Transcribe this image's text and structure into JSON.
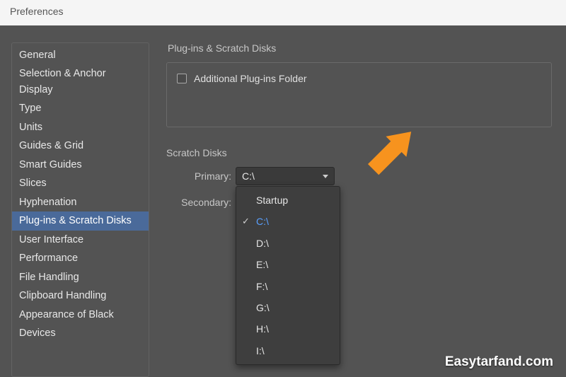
{
  "window": {
    "title": "Preferences"
  },
  "sidebar": {
    "items": [
      {
        "label": "General"
      },
      {
        "label": "Selection & Anchor Display"
      },
      {
        "label": "Type"
      },
      {
        "label": "Units"
      },
      {
        "label": "Guides & Grid"
      },
      {
        "label": "Smart Guides"
      },
      {
        "label": "Slices"
      },
      {
        "label": "Hyphenation"
      },
      {
        "label": "Plug-ins & Scratch Disks",
        "selected": true
      },
      {
        "label": "User Interface"
      },
      {
        "label": "Performance"
      },
      {
        "label": "File Handling"
      },
      {
        "label": "Clipboard Handling"
      },
      {
        "label": "Appearance of Black"
      },
      {
        "label": "Devices"
      }
    ]
  },
  "plugins": {
    "section_title": "Plug-ins & Scratch Disks",
    "checkbox_label": "Additional Plug-ins Folder"
  },
  "scratch": {
    "section_title": "Scratch Disks",
    "primary_label": "Primary:",
    "secondary_label": "Secondary:",
    "primary_value": "C:\\",
    "options": [
      {
        "label": "Startup"
      },
      {
        "label": "C:\\",
        "selected": true
      },
      {
        "label": "D:\\"
      },
      {
        "label": "E:\\"
      },
      {
        "label": "F:\\"
      },
      {
        "label": "G:\\"
      },
      {
        "label": "H:\\"
      },
      {
        "label": "I:\\"
      }
    ]
  },
  "watermark": "Easytarfand.com"
}
